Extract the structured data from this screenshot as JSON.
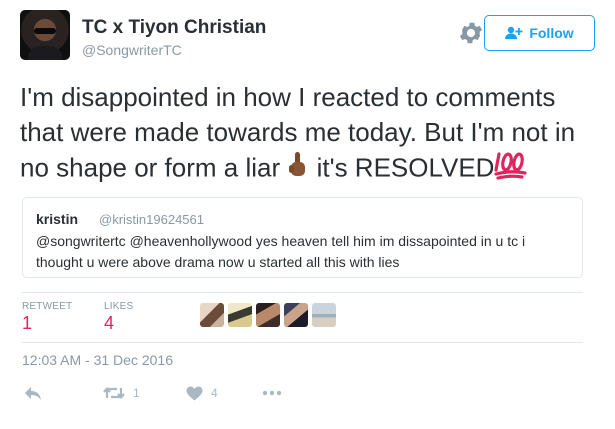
{
  "user": {
    "display_name": "TC x Tiyon Christian",
    "handle": "@SongwriterTC"
  },
  "follow_button": {
    "label": "Follow"
  },
  "tweet": {
    "text_part1": "I'm disappointed in how I reacted to comments that were made towards me today. But I'm not in no shape or form a liar",
    "text_part2": " it's RESOLVED"
  },
  "quoted_tweet": {
    "name": "kristin",
    "handle": "@kristin19624561",
    "text": "@songwritertc @heavenhollywood yes heaven tell him im dissapointed in u tc i thought u were above drama now u started all this with lies"
  },
  "stats": {
    "retweets_label": "RETWEET",
    "retweets_value": "1",
    "likes_label": "LIKES",
    "likes_value": "4"
  },
  "timestamp": "12:03 AM - 31 Dec 2016",
  "actions": {
    "retweet_count": "1",
    "like_count": "4"
  },
  "colors": {
    "accent": "#1da1f2",
    "stat_value": "#e0245e",
    "muted": "#8899a6",
    "text": "#292f33"
  }
}
